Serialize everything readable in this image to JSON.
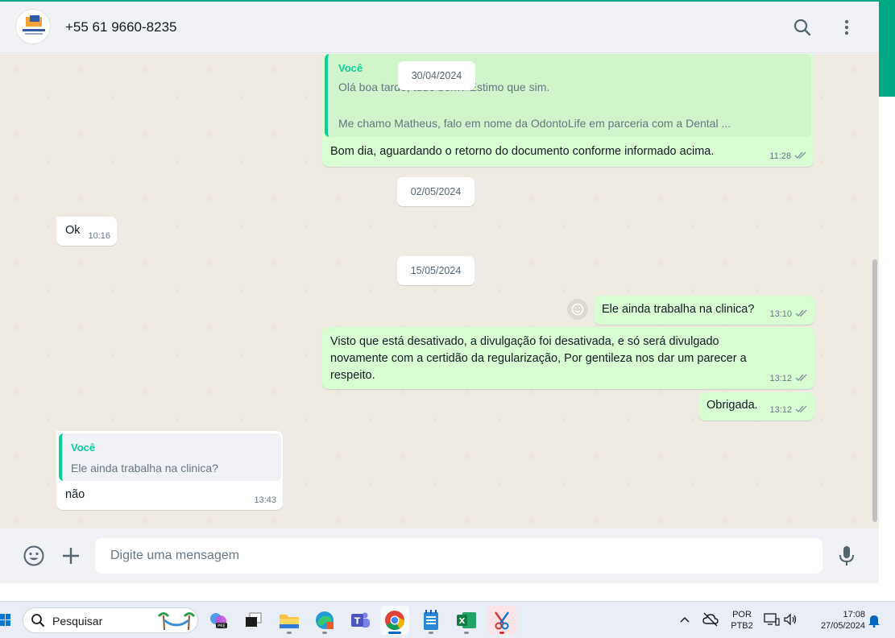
{
  "header": {
    "contact_name": "+55 61 9660-8235"
  },
  "messages": {
    "quoted_author": "Você",
    "quoted_line1": "Olá boa tarde, tudo bem? Estimo que sim.",
    "quoted_line2": "Me chamo Matheus, falo em nome da OdontoLife em parceria com a Dental ...",
    "m1_text": "Bom dia, aguardando o retorno do documento conforme informado acima.",
    "m1_time": "11:28",
    "m2_text": "Ok",
    "m2_time": "10:16",
    "m3_text": "Ele ainda trabalha na clinica?",
    "m3_time": "13:10",
    "m4_line1": "Visto que está desativado, a divulgação foi desativada, e só será divulgado",
    "m4_line2": "novamente com a certidão da regularização, Por gentileza nos dar um parecer a",
    "m4_line3": "respeito.",
    "m4_time": "13:12",
    "m5_text": "Obrigada.",
    "m5_time": "13:12",
    "reply_author": "Você",
    "reply_quote": "Ele ainda trabalha na clinica?",
    "m6_text": "não",
    "m6_time": "13:43"
  },
  "dates": {
    "d1": "30/04/2024",
    "d2": "02/05/2024",
    "d3": "15/05/2024"
  },
  "composer": {
    "placeholder": "Digite uma mensagem"
  },
  "taskbar": {
    "search_label": "Pesquisar",
    "lang_line1": "POR",
    "lang_line2": "PTB2",
    "time": "17:08",
    "date": "27/05/2024"
  },
  "colors": {
    "accent": "#00a884",
    "outgoing_bubble": "#d9fdd3",
    "incoming_bubble": "#ffffff",
    "quote_author": "#06cf9c"
  }
}
